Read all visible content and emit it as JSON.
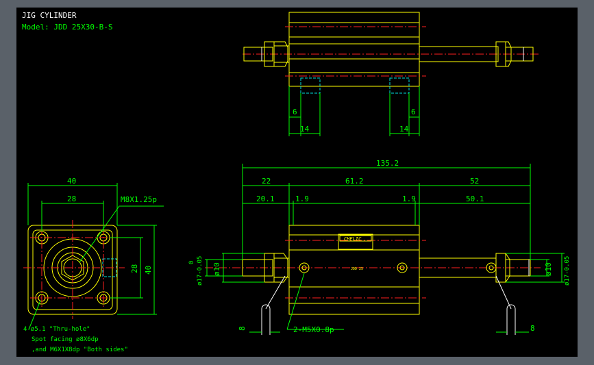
{
  "title": "JIG CYLINDER",
  "model": "Model: JDD 25X30-B-S",
  "top_view": {
    "dims": [
      "6",
      "6",
      "14",
      "14"
    ]
  },
  "side_view": {
    "overall": "135.2",
    "upper": [
      "22",
      "61.2",
      "52"
    ],
    "lower": [
      "20.1",
      "1.9",
      "1.9",
      "50.1"
    ],
    "left_dia": [
      "ø10",
      "ø17-0.05",
      "0"
    ],
    "right_dia": [
      "ø10",
      "ø17-0.05",
      "0"
    ],
    "port": "2-M5X0.8p",
    "left_wrench": "8",
    "right_wrench": "8",
    "brand": "CHELIC",
    "center_mark": "JDD 25"
  },
  "end_view": {
    "width_outer": "40",
    "width_inner": "28",
    "height_inner": "28",
    "height_outer": "40",
    "thread": "M8X1.25p",
    "notes": [
      "4-ø5.1 \"Thru-hole\"",
      "Spot facing ø8X6dp",
      ",and M6X1X8dp \"Both sides\""
    ]
  }
}
